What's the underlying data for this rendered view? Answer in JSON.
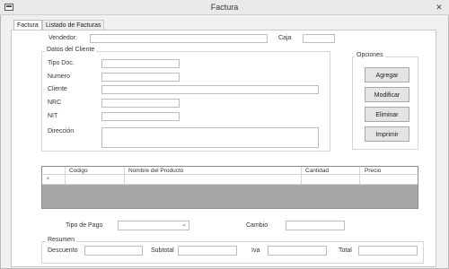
{
  "window": {
    "title": "Factura",
    "close_glyph": "✕"
  },
  "tabs": [
    {
      "label": "Factura",
      "active": true
    },
    {
      "label": "Listado de Facturas",
      "active": false
    }
  ],
  "header": {
    "vendedor_label": "Vendedor:",
    "caja_label": "Caja"
  },
  "cliente": {
    "group_title": "Datos del Cliente",
    "tipo_doc": "Tipo Doc.",
    "numero": "Numero",
    "cliente": "Cliente",
    "nrc": "NRC",
    "nit": "NIT",
    "direccion": "Dirección"
  },
  "opciones": {
    "group_title": "Opciones",
    "buttons": [
      "Agregar",
      "Modificar",
      "Eliminar",
      "Imprimir"
    ]
  },
  "grid": {
    "columns": [
      "Codigo",
      "Nombre del Producto",
      "Cantidad",
      "Precio"
    ],
    "new_row_marker": "*"
  },
  "pago": {
    "tipo_label": "Tipo de Pago",
    "cambio_label": "Cambio",
    "chevron": "⌄"
  },
  "resumen": {
    "group_title": "Resumen",
    "descuento": "Descuento",
    "subtotal": "Subtotal",
    "iva": "Iva",
    "total": "Total"
  }
}
